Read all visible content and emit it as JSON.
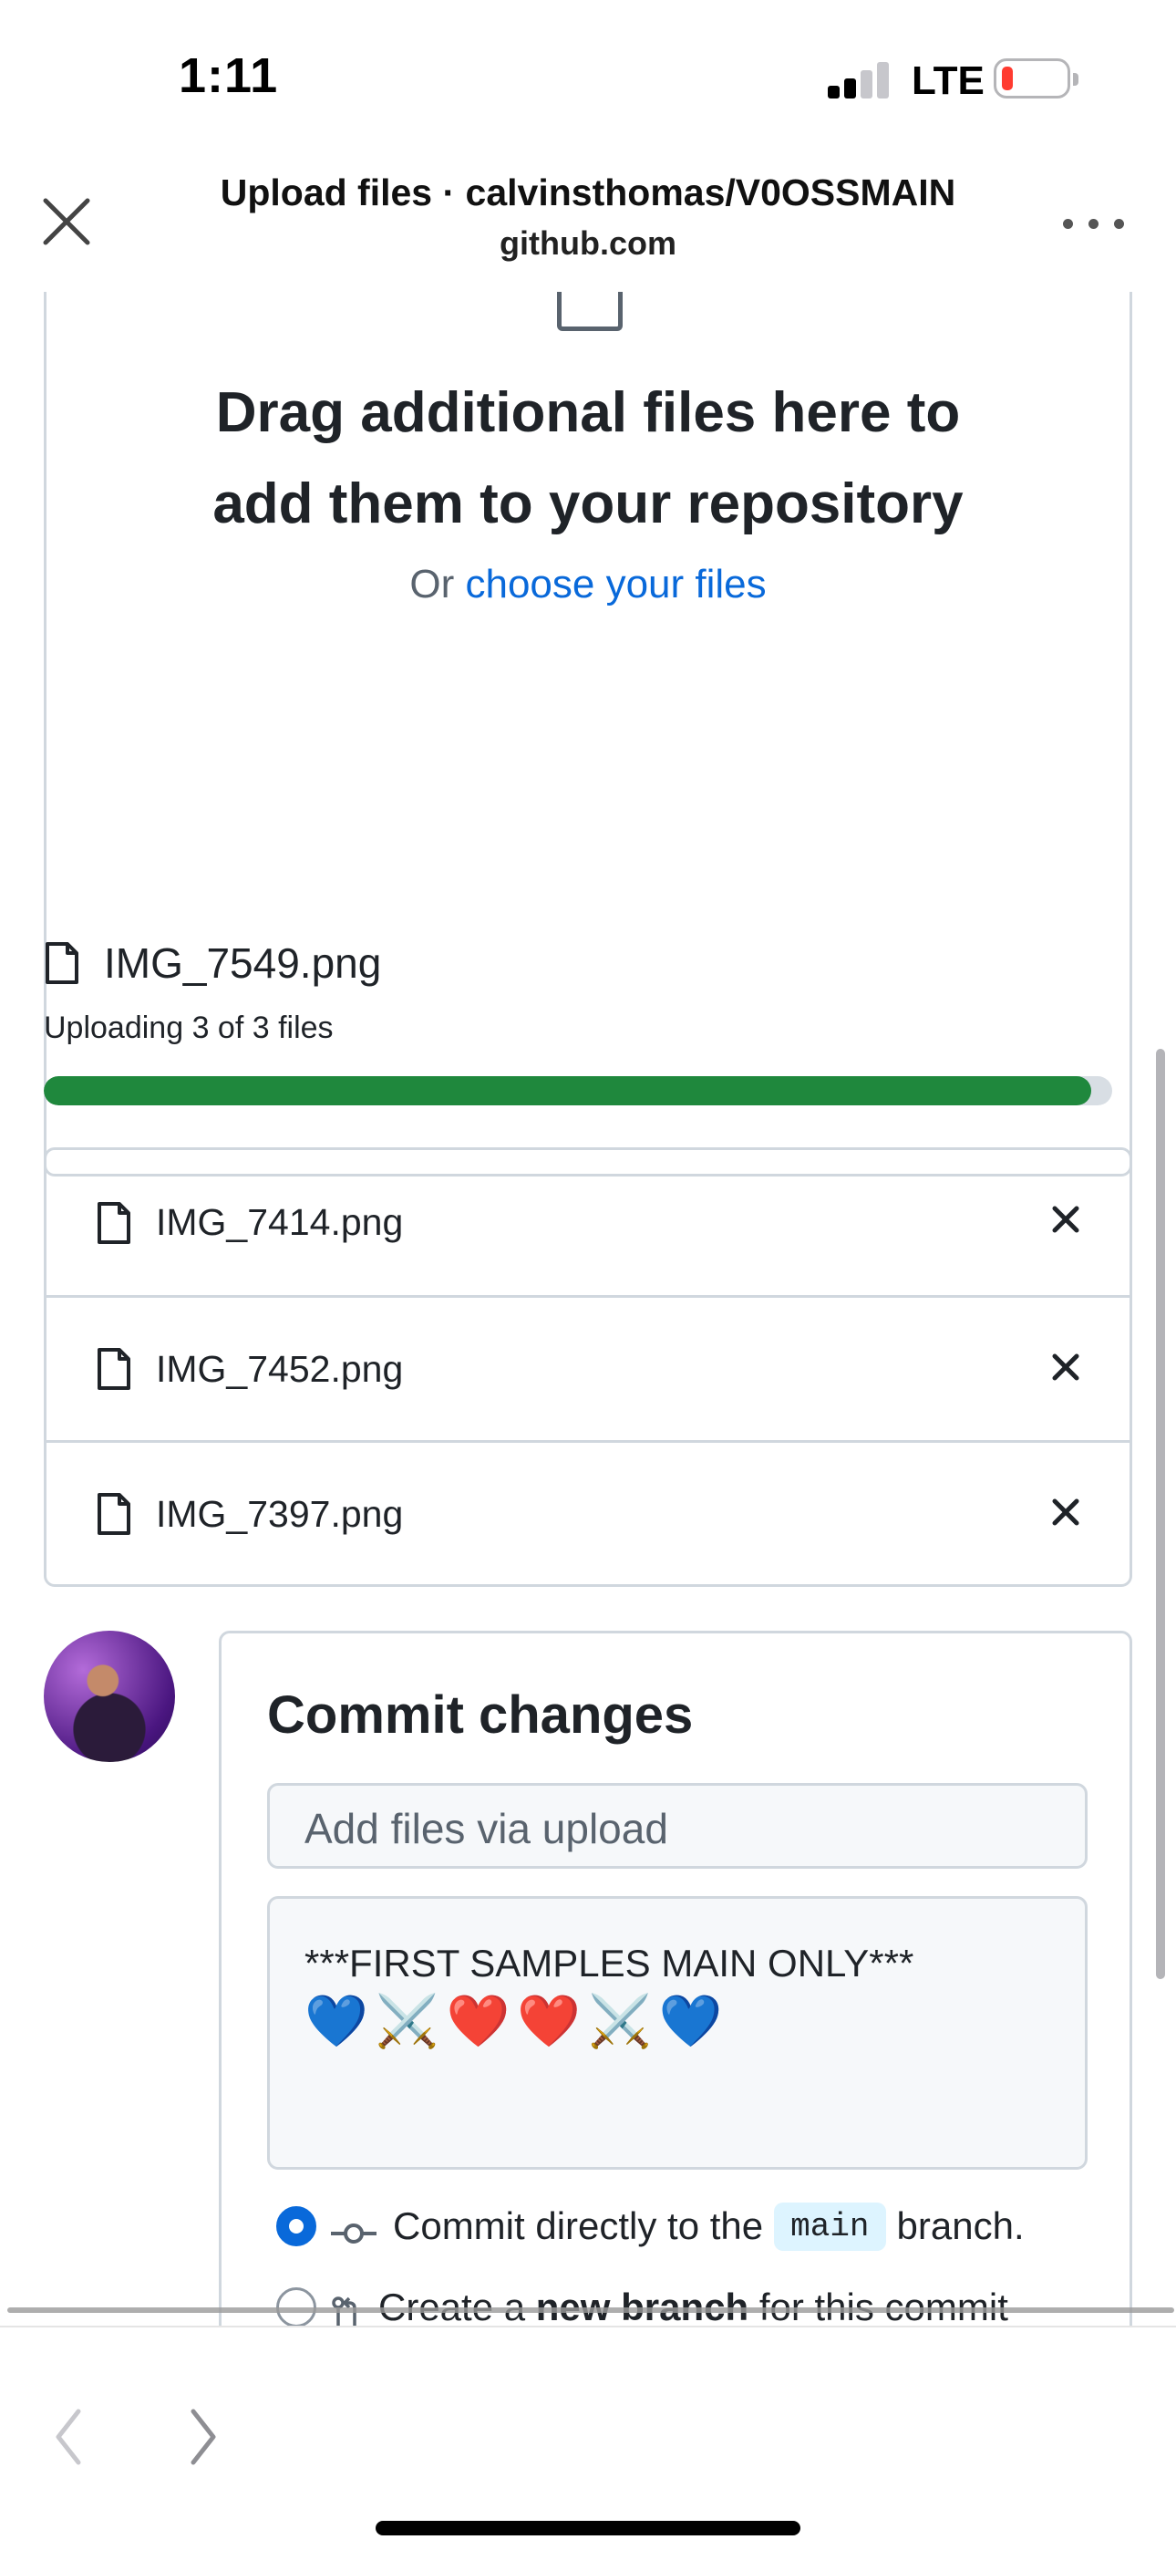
{
  "status_bar": {
    "time": "1:11",
    "network": "LTE",
    "signal_bars_active": 2,
    "signal_bars_total": 4,
    "battery_level": 0.12,
    "battery_color": "#ff3b30"
  },
  "header": {
    "title": "Upload files · calvinsthomas/V0OSSMAIN",
    "subtitle": "github.com",
    "close_icon": "close-icon",
    "more_icon": "more-horizontal-icon"
  },
  "dropzone": {
    "heading_line1": "Drag additional files here to",
    "heading_line2": "add them to your repository",
    "or_text": "Or ",
    "choose_link": "choose your files",
    "link_color": "#0969da"
  },
  "upload": {
    "current_file": "IMG_7549.png",
    "status": "Uploading 3 of 3 files",
    "progress": 0.98,
    "progress_color": "#1f883d"
  },
  "files": [
    {
      "name": "IMG_7414.png"
    },
    {
      "name": "IMG_7452.png"
    },
    {
      "name": "IMG_7397.png"
    }
  ],
  "commit": {
    "title": "Commit changes",
    "summary_placeholder": "Add files via upload",
    "description": "***FIRST SAMPLES MAIN ONLY***",
    "description_emoji": [
      "💙",
      "⚔️",
      "❤️",
      "❤️",
      "⚔️",
      "💙"
    ],
    "option_direct_prefix": "Commit directly to the",
    "option_direct_branch": "main",
    "option_direct_suffix": "branch.",
    "option_new_prefix": "Create a",
    "option_new_bold": "new branch",
    "option_new_suffix": "for this commit"
  },
  "toolbar": {
    "back_icon": "chevron-left-icon",
    "forward_icon": "chevron-right-icon"
  }
}
